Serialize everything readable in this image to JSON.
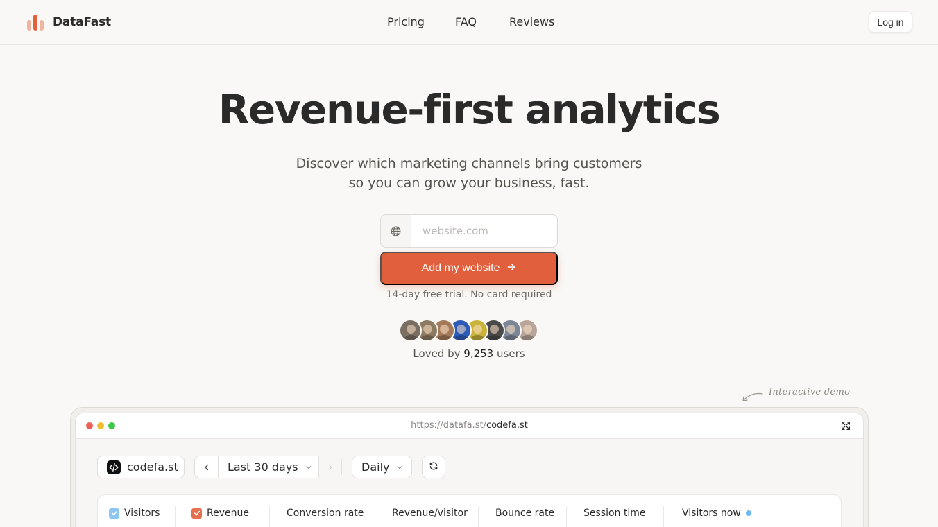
{
  "nav": {
    "brand": "DataFast",
    "links": [
      "Pricing",
      "FAQ",
      "Reviews"
    ],
    "login_label": "Log in"
  },
  "hero": {
    "title": "Revenue-first analytics",
    "subtitle_line1": "Discover which marketing channels bring customers",
    "subtitle_line2": "so you can grow your business, fast.",
    "input_placeholder": "website.com",
    "cta_label": "Add my website",
    "trial_note": "14-day free trial. No card required",
    "loved_prefix": "Loved by",
    "loved_count": "9,253",
    "loved_suffix": "users"
  },
  "avatars": [
    "#7a6e63",
    "#8c7a61",
    "#a47a5a",
    "#2c5bb8",
    "#c9b33a",
    "#4a4a4a",
    "#7c8796",
    "#b9a49a"
  ],
  "demo": {
    "note": "Interactive demo",
    "url_base": "https://datafa.st/",
    "url_path": "codefa.st",
    "site_name": "codefa.st",
    "range_label": "Last 30 days",
    "granularity": "Daily",
    "metrics": {
      "visitors": "Visitors",
      "revenue": "Revenue",
      "conversion_rate": "Conversion rate",
      "revenue_per_visitor": "Revenue/visitor",
      "bounce_rate": "Bounce rate",
      "session_time": "Session time",
      "visitors_now": "Visitors now"
    }
  },
  "colors": {
    "accent": "#e15f3c",
    "background": "#f9f8f6",
    "visitors_checkbox": "#8cc7f3",
    "revenue_checkbox": "#e5714f"
  }
}
